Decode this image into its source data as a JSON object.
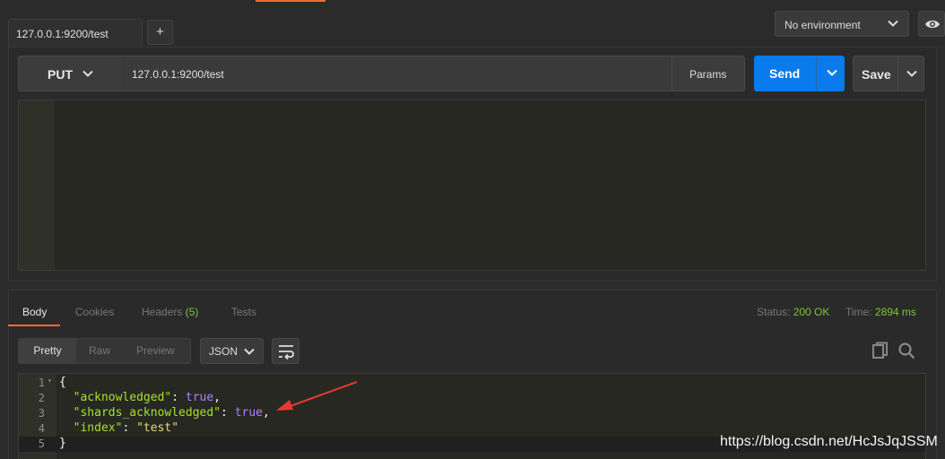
{
  "tabs": [
    {
      "label": "127.0.0.1:9200/test"
    }
  ],
  "add_tab_label": "+",
  "environment": {
    "selected": "No environment"
  },
  "icons": {
    "eye": "eye-icon",
    "chevron": "chevron-down-icon",
    "wrap": "wrap-lines-icon",
    "copy": "copy-icon",
    "search": "search-icon"
  },
  "request": {
    "method": "PUT",
    "url": "127.0.0.1:9200/test",
    "params_label": "Params",
    "send_label": "Send",
    "save_label": "Save"
  },
  "response": {
    "tabs": [
      {
        "label": "Body"
      },
      {
        "label": "Cookies"
      },
      {
        "label": "Headers",
        "count": "(5)"
      },
      {
        "label": "Tests"
      }
    ],
    "status_label": "Status:",
    "status_value": "200 OK",
    "time_label": "Time:",
    "time_value": "2894 ms",
    "view_modes": [
      "Pretty",
      "Raw",
      "Preview"
    ],
    "format": "JSON",
    "body_lines": [
      {
        "n": "1",
        "tokens": [
          {
            "t": "{",
            "c": "punc"
          }
        ]
      },
      {
        "n": "2",
        "tokens": [
          {
            "t": "  ",
            "c": "punc"
          },
          {
            "t": "\"acknowledged\"",
            "c": "key"
          },
          {
            "t": ": ",
            "c": "punc"
          },
          {
            "t": "true",
            "c": "bool"
          },
          {
            "t": ",",
            "c": "punc"
          }
        ]
      },
      {
        "n": "3",
        "tokens": [
          {
            "t": "  ",
            "c": "punc"
          },
          {
            "t": "\"shards_acknowledged\"",
            "c": "key"
          },
          {
            "t": ": ",
            "c": "punc"
          },
          {
            "t": "true",
            "c": "bool"
          },
          {
            "t": ",",
            "c": "punc"
          }
        ]
      },
      {
        "n": "4",
        "tokens": [
          {
            "t": "  ",
            "c": "punc"
          },
          {
            "t": "\"index\"",
            "c": "key"
          },
          {
            "t": ": ",
            "c": "punc"
          },
          {
            "t": "\"test\"",
            "c": "str"
          }
        ]
      },
      {
        "n": "5",
        "tokens": [
          {
            "t": "}",
            "c": "punc"
          }
        ]
      }
    ]
  },
  "watermark": "https://blog.csdn.net/HcJsJqJSSM",
  "colors": {
    "accent": "#f26b3a",
    "send": "#097bed",
    "success": "#7ec536",
    "arrow": "#e53935"
  }
}
